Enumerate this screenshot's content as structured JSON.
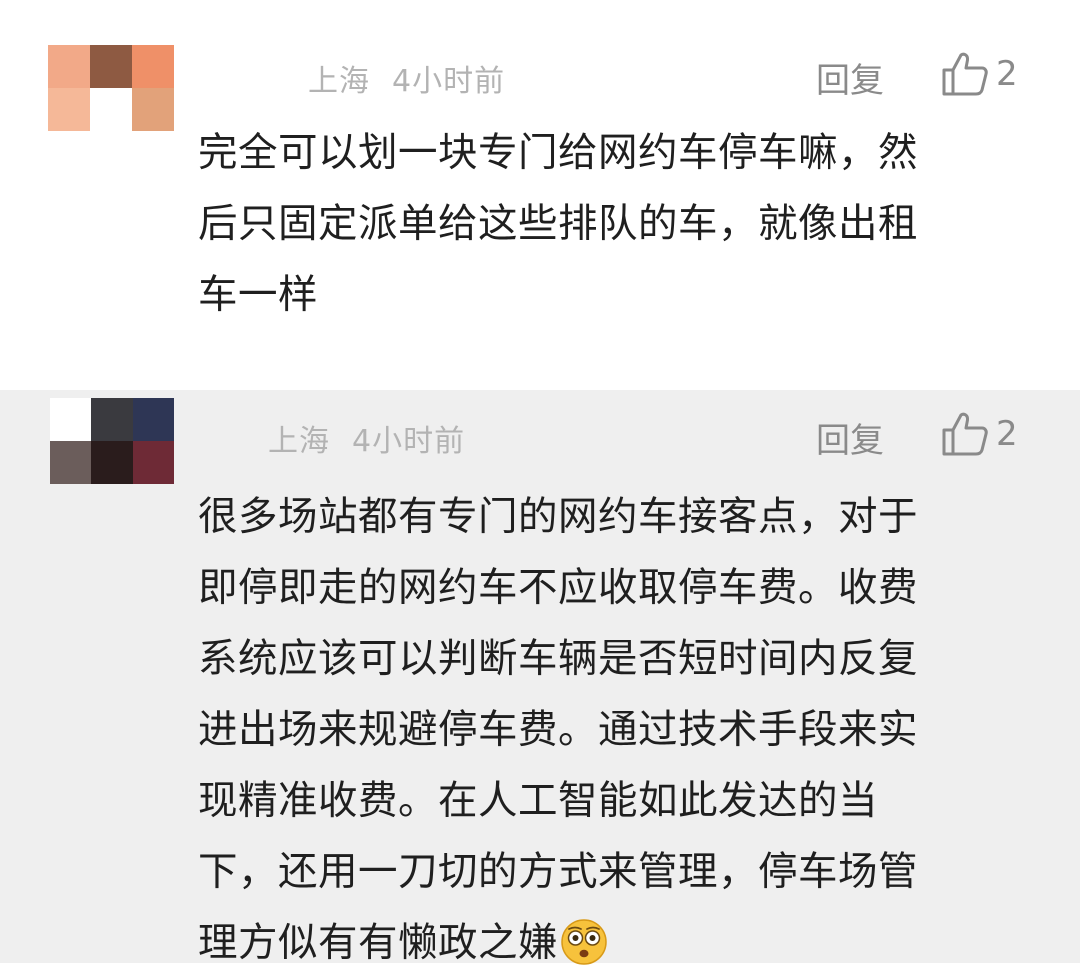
{
  "comments": [
    {
      "location": "上海",
      "time": "4小时前",
      "reply_label": "回复",
      "like_count": "2",
      "avatar_colors": [
        "#f2a988",
        "#8e5a42",
        "#ef9068",
        "#f5b898",
        "#ffffff",
        "#e2a27a"
      ],
      "lines": [
        "完全可以划一块专门给网约车停车嘛，然",
        "后只固定派单给这些排队的车，就像出租",
        "车一样"
      ]
    },
    {
      "location": "上海",
      "time": "4小时前",
      "reply_label": "回复",
      "like_count": "2",
      "avatar_colors": [
        "#ffffff",
        "#3a3a3f",
        "#2e3655",
        "#6b5d5b",
        "#2a1c1c",
        "#6e2a36"
      ],
      "lines": [
        "很多场站都有专门的网约车接客点，对于",
        "即停即走的网约车不应收取停车费。收费",
        "系统应该可以判断车辆是否短时间内反复",
        "进出场来规避停车费。通过技术手段来实",
        "现精准收费。在人工智能如此发达的当",
        "下，还用一刀切的方式来管理，停车场管",
        "理方似有有懒政之嫌"
      ],
      "trailing_emoji": "flushed-face-emoji"
    }
  ],
  "colors": {
    "meta_text": "#b3b3b3",
    "action_text": "#8a8a8a",
    "body_text": "#1f1f1f",
    "second_comment_bg": "#efefef"
  },
  "icons": {
    "like": "thumbs-up-icon"
  }
}
